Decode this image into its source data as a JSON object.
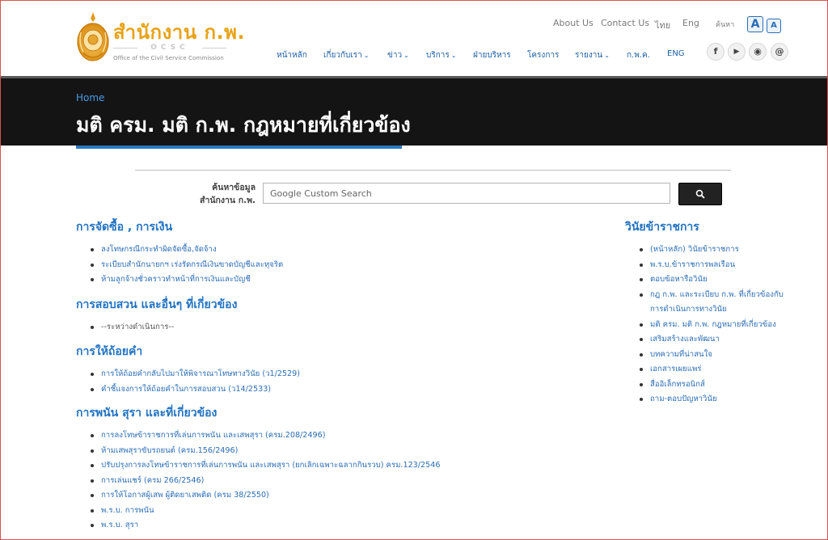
{
  "header": {
    "logo": {
      "title": "สำนักงาน ก.พ.",
      "abbr": "OCSC",
      "subtitle": "Office of the Civil Service Commission"
    },
    "top_links": [
      "About Us",
      "Contact Us",
      "ไทย",
      "Eng",
      "ค้นหา"
    ],
    "font_size": {
      "large": "A",
      "small": "A"
    },
    "nav": [
      {
        "label": "หน้าหลัก",
        "dropdown": false
      },
      {
        "label": "เกี่ยวกับเรา",
        "dropdown": true
      },
      {
        "label": "ข่าว",
        "dropdown": true
      },
      {
        "label": "บริการ",
        "dropdown": true
      },
      {
        "label": "ฝ่ายบริหาร",
        "dropdown": false
      },
      {
        "label": "โครงการ",
        "dropdown": false
      },
      {
        "label": "รายงาน",
        "dropdown": true
      },
      {
        "label": "ก.พ.ค.",
        "dropdown": false
      },
      {
        "label": "ENG",
        "dropdown": false
      }
    ],
    "social": [
      {
        "glyph": "f",
        "icon": "facebook-icon"
      },
      {
        "glyph": "▶",
        "icon": "youtube-icon"
      },
      {
        "glyph": "◉",
        "icon": "rss-icon"
      },
      {
        "glyph": "@",
        "icon": "email-icon"
      }
    ]
  },
  "banner": {
    "breadcrumb": "Home",
    "title": "มติ ครม. มติ ก.พ. กฎหมายที่เกี่ยวข้อง"
  },
  "search": {
    "label_line1": "ค้นหาข้อมูล",
    "label_line2": "สำนักงาน ก.พ.",
    "placeholder": "Google Custom Search",
    "button_glyph": "🔍"
  },
  "sections": [
    {
      "title": "การจัดซื้อ , การเงิน",
      "items": [
        "ลงโทษกรณีกระทำผิดจัดซื้อ,จัดจ้าง",
        "ระเบียบสำนักนายกฯ เร่งรัดกรณีเงินขาดบัญชีและทุจริต",
        "ห้ามลูกจ้างชั่วคราวทำหน้าที่การเงินและบัญชี"
      ]
    },
    {
      "title": "การสอบสวน และอื่นๆ ที่เกี่ยวข้อง",
      "items": [
        "--ระหว่างดำเนินการ--"
      ]
    },
    {
      "title": "การให้ถ้อยคำ",
      "items": [
        "การให้ถ้อยคำกลับไปมาให้พิจารณาโทษทางวินัย (ว1/2529)",
        "คำชี้แจงการให้ถ้อยคำในการสอบสวน (ว14/2533)"
      ]
    },
    {
      "title": "การพนัน  สุรา  และที่เกี่ยวข้อง",
      "items": [
        "การลงโทษข้าราชการที่เล่นการพนัน และเสพสุรา (ครม.208/2496)",
        "ห้ามเสพสุราขับรถยนต์ (ครม.156/2496)",
        "ปรับปรุงการลงโทษข้าราชการที่เล่นการพนัน และเสพสุรา (ยกเลิกเฉพาะฉลากกินรวบ) ครม.123/2546",
        "การเล่นแชร์ (ครม 266/2546)",
        "การให้โอกาสผู้เสพ ผู้ติดยาเสพติด (ครม 38/2550)",
        "พ.ร.บ. การพนัน",
        "พ.ร.บ. สุรา"
      ]
    }
  ],
  "sidebar": {
    "title": "วินัยข้าราชการ",
    "items": [
      "(หน้าหลัก) วินัยข้าราชการ",
      "พ.ร.บ.ข้าราชการพลเรือน",
      "ตอบข้อหารือวินัย",
      "กฎ ก.พ. และระเบียบ ก.พ. ที่เกี่ยวข้องกับการดำเนินการทางวินัย",
      "มติ ครม. มติ ก.พ. กฎหมายที่เกี่ยวข้อง",
      "เสริมสร้างและพัฒนา",
      "บทความที่น่าสนใจ",
      "เอกสารเผยแพร่",
      "สื่ออิเล็กทรอนิกส์",
      "ถาม-ตอบปัญหาวินัย"
    ]
  },
  "colors": {
    "brand_gold": "#e8a317",
    "link_blue": "#2a6db5",
    "heading_blue": "#2273c3",
    "banner_bg": "#141414",
    "accent_bar": "#2a79c4"
  }
}
